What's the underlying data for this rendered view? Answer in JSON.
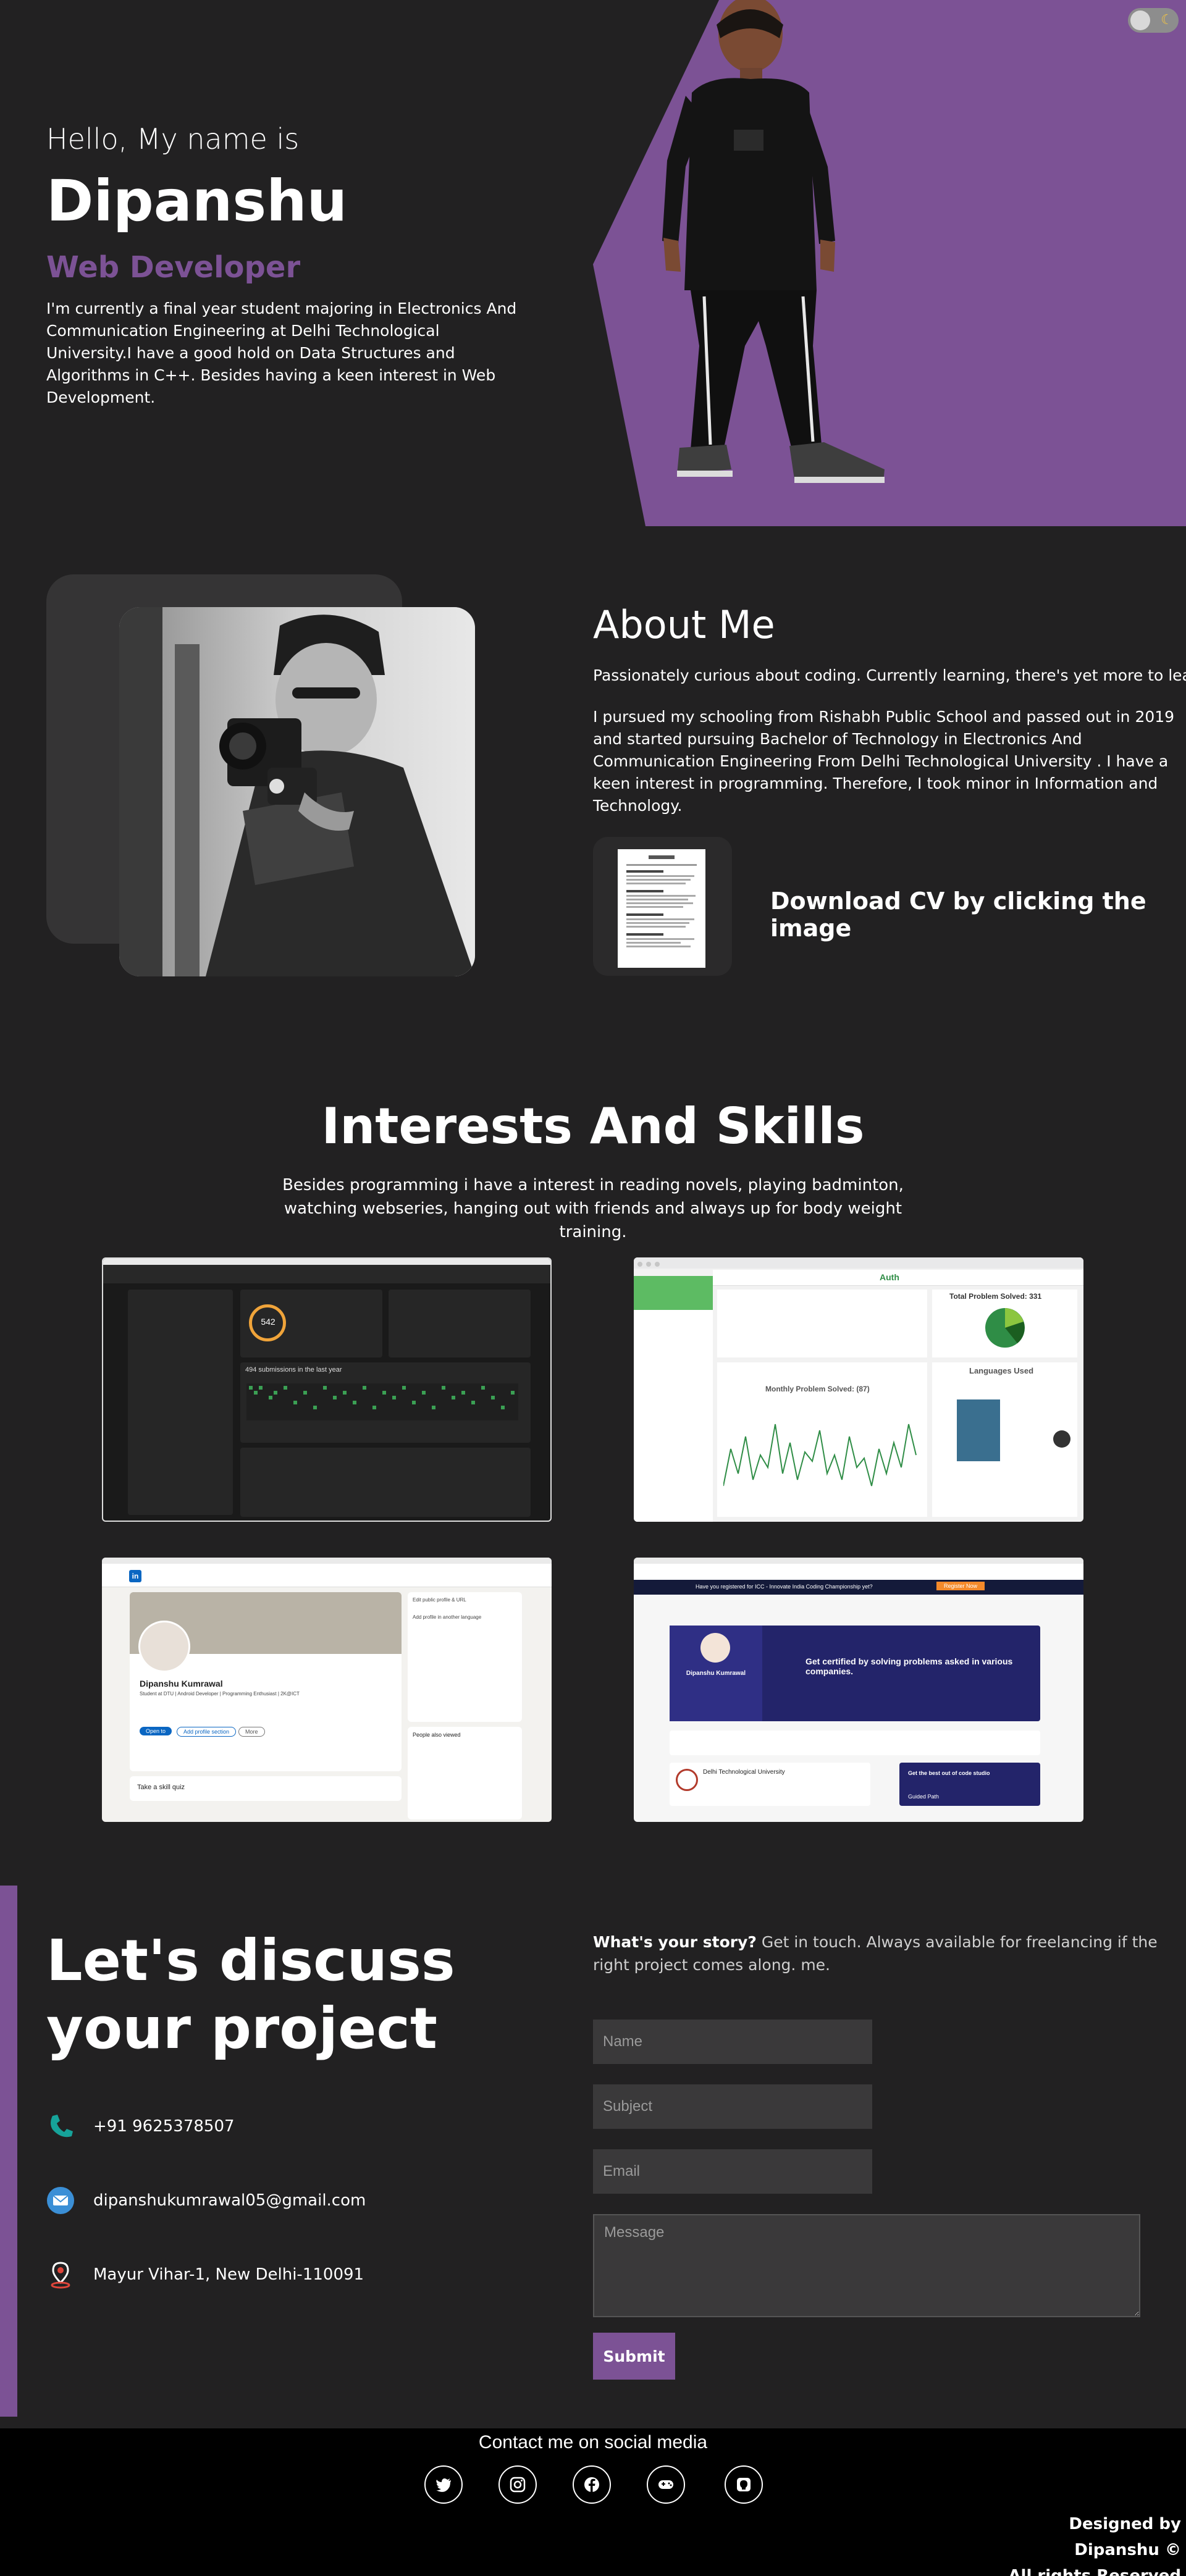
{
  "hero": {
    "greeting": "Hello, My name is",
    "name": "Dipanshu",
    "role": "Web Developer",
    "description": "I'm currently a final year student majoring in Electronics And Communication Engineering at Delhi Technological University.I have a good hold on Data Structures and Algorithms in C++. Besides having a keen interest in Web Development."
  },
  "theme_toggle": {
    "icon": "moon-icon"
  },
  "about": {
    "title": "About Me",
    "tagline": "Passionately curious about coding. Currently learning, there's yet more to learn",
    "body": "I pursued my schooling from Rishabh Public School and passed out in 2019 and started pursuing Bachelor of Technology in Electronics And Communication Engineering From Delhi Technological University . I have a keen interest in programming. Therefore, I took minor in Information and Technology.",
    "cv_label": "Download CV by clicking the image"
  },
  "skills": {
    "title": "Interests And Skills",
    "description": "Besides programming i have a interest in reading novels, playing badminton, watching webseries, hanging out with friends and always up for body weight training.",
    "screenshots": [
      {
        "name": "LeetCode profile",
        "heading": "494 submissions in the last year",
        "stat": "542"
      },
      {
        "name": "GeeksforGeeks profile",
        "heading": "Total Problem Solved: 331",
        "sub": "Monthly Problem Solved: (87)",
        "brand": "Auth",
        "side": "Languages Used"
      },
      {
        "name": "LinkedIn profile",
        "person": "Dipanshu Kumrawal",
        "headline": "Student at DTU | Android Developer | Programming Enthusiast | 2K@ICT",
        "open_to": "Open to",
        "add_section": "Add profile section",
        "more": "More",
        "quiz": "Take a skill quiz",
        "side1": "Edit public profile & URL",
        "side2": "Add profile in another language",
        "side3": "People also viewed"
      },
      {
        "name": "CodeStudio profile",
        "banner": "Have you registered for ICC - Innovate India Coding Championship yet?",
        "register": "Register Now",
        "person": "Dipanshu Kumrawal",
        "cert": "Get certified by solving problems asked in various companies.",
        "college": "Delhi Technological University",
        "guided": "Guided Path",
        "best": "Get the best out of code studio"
      }
    ]
  },
  "contact": {
    "title": "Let's discuss your project",
    "phone": "+91 9625378507",
    "email": "dipanshukumrawal05@gmail.com",
    "address": "Mayur Vihar-1, New Delhi-110091",
    "story_bold": "What's your story?",
    "story_rest": " Get in touch. Always available for freelancing if the right project comes along. me.",
    "placeholders": {
      "name": "Name",
      "subject": "Subject",
      "email": "Email",
      "message": "Message"
    },
    "submit": "Submit"
  },
  "footer": {
    "title": "Contact me on social media",
    "social_icons": [
      "twitter-icon",
      "instagram-icon",
      "facebook-icon",
      "gamepad-icon",
      "github-icon"
    ],
    "credit_line1": "Designed by Dipanshu ©",
    "credit_line2": "All rights Reserved"
  },
  "colors": {
    "background": "#222122",
    "accent": "#7c5295",
    "footer": "#000000"
  }
}
